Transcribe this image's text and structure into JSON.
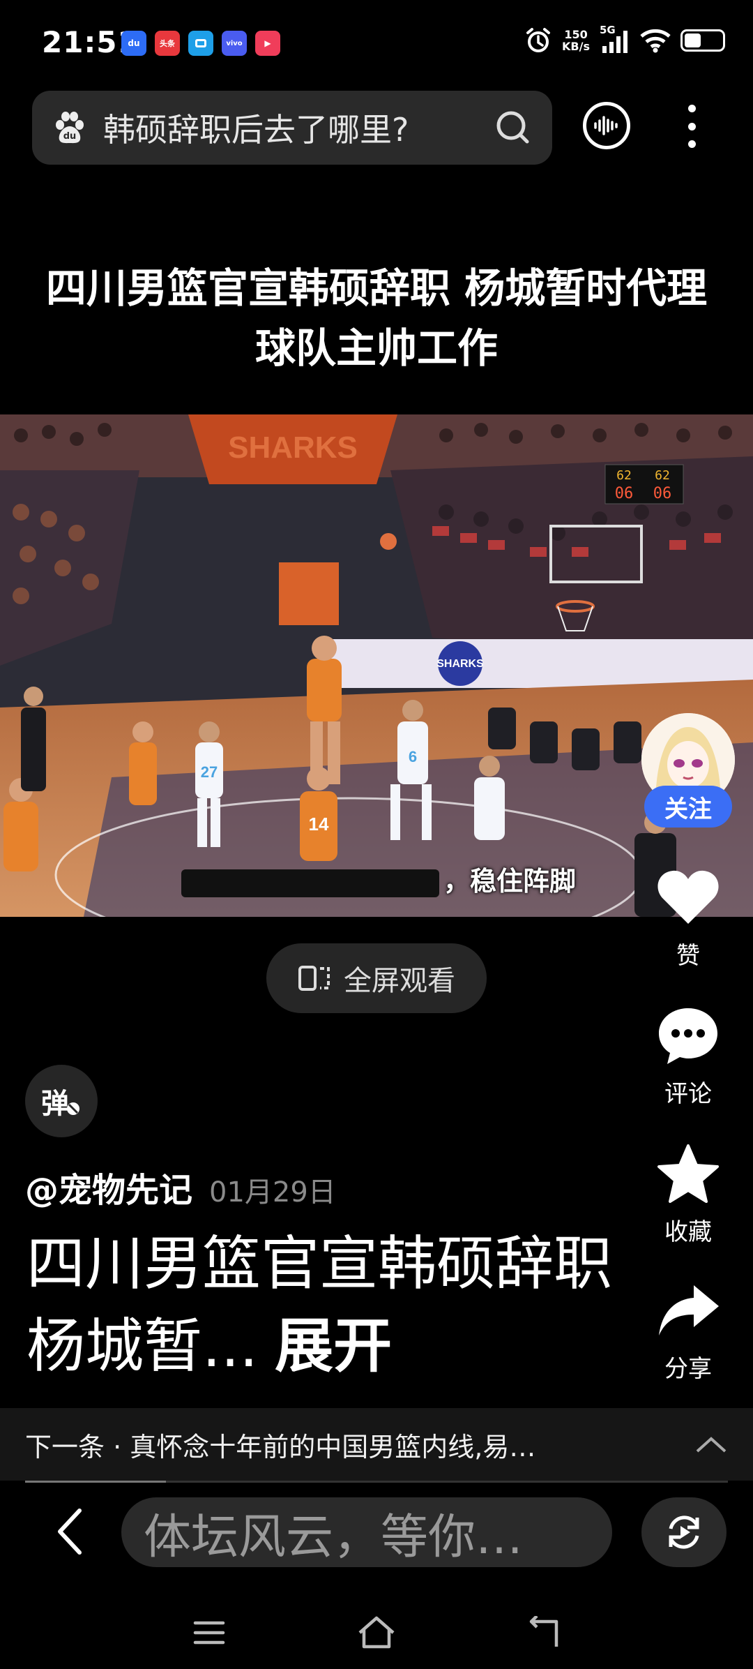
{
  "status_bar": {
    "time": "21:51",
    "apps": [
      {
        "icon": "baidu-icon",
        "label": "du",
        "color": "#2d6cf5"
      },
      {
        "icon": "toutiao-icon",
        "label": "头条",
        "color": "#e8383d"
      },
      {
        "icon": "app-blue-icon",
        "label": "",
        "color": "#1e9fe8"
      },
      {
        "icon": "vivo-icon",
        "label": "vivo",
        "color": "#4a5cf0"
      },
      {
        "icon": "video-app-icon",
        "label": "▶",
        "color": "#f03d5a"
      }
    ],
    "net_speed_value": "150",
    "net_speed_unit": "KB/s",
    "network": "5G",
    "battery_level": 0.45
  },
  "search": {
    "query": "韩硕辞职后去了哪里?",
    "icons": {
      "left": "baidu-paw-icon",
      "right": "search-icon"
    }
  },
  "header_actions": {
    "voice": "voice-search-icon",
    "more": "more-vertical-icon"
  },
  "headline": "四川男篮官宣韩硕辞职 杨城暂时代理球队主帅工作",
  "video": {
    "subtitle": "，稳住阵脚",
    "scoreboard": [
      "62",
      "06",
      "62",
      "06"
    ]
  },
  "fullscreen": {
    "label": "全屏观看",
    "icon": "fullscreen-icon"
  },
  "side_actions": {
    "follow": "关注",
    "like": "赞",
    "comment": "评论",
    "collect": "收藏",
    "share": "分享"
  },
  "danmaku": {
    "label": "弹"
  },
  "post": {
    "author": "@宠物先记",
    "date": "01月29日",
    "title": "四川男篮官宣韩硕辞职 杨城暂...",
    "expand": "展开"
  },
  "next": {
    "label": "下一条 · 真怀念十年前的中国男篮内线,易…",
    "progress": 0.2
  },
  "comment_bar": {
    "placeholder": "体坛风云，等你…"
  },
  "colors": {
    "accent": "#3b6ef5",
    "background": "#000000",
    "card": "#2a2a2a"
  }
}
